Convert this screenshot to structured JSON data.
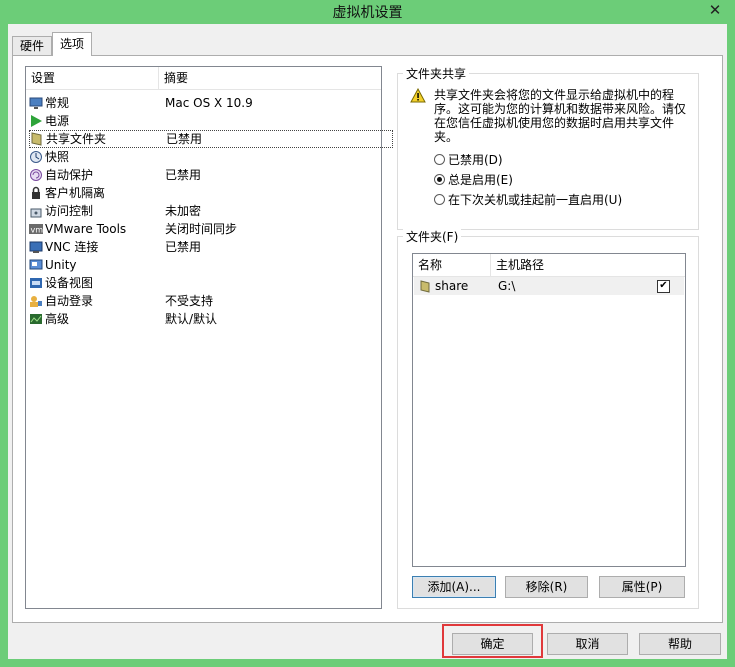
{
  "window": {
    "title": "虚拟机设置",
    "close_glyph": "✕"
  },
  "tabs": [
    {
      "label": "硬件"
    },
    {
      "label": "选项"
    }
  ],
  "settings_list": {
    "columns": [
      "设置",
      "摘要"
    ],
    "items": [
      {
        "name": "常规",
        "summary": "Mac OS X 10.9",
        "icon": "monitor-icon"
      },
      {
        "name": "电源",
        "summary": "",
        "icon": "play-icon"
      },
      {
        "name": "共享文件夹",
        "summary": "已禁用",
        "icon": "shared-folder-icon"
      },
      {
        "name": "快照",
        "summary": "",
        "icon": "snapshot-icon"
      },
      {
        "name": "自动保护",
        "summary": "已禁用",
        "icon": "autoprotect-icon"
      },
      {
        "name": "客户机隔离",
        "summary": "",
        "icon": "lock-icon"
      },
      {
        "name": "访问控制",
        "summary": "未加密",
        "icon": "access-control-icon"
      },
      {
        "name": "VMware Tools",
        "summary": "关闭时间同步",
        "icon": "vm-icon"
      },
      {
        "name": "VNC 连接",
        "summary": "已禁用",
        "icon": "vnc-icon"
      },
      {
        "name": "Unity",
        "summary": "",
        "icon": "unity-icon"
      },
      {
        "name": "设备视图",
        "summary": "",
        "icon": "device-view-icon"
      },
      {
        "name": "自动登录",
        "summary": "不受支持",
        "icon": "autologin-icon"
      },
      {
        "name": "高级",
        "summary": "默认/默认",
        "icon": "advanced-icon"
      }
    ]
  },
  "sharing": {
    "title": "文件夹共享",
    "warning": "共享文件夹会将您的文件显示给虚拟机中的程序。这可能为您的计算机和数据带来风险。请仅在您信任虚拟机使用您的数据时启用共享文件夹。",
    "options": [
      {
        "label": "已禁用(D)",
        "checked": false
      },
      {
        "label": "总是启用(E)",
        "checked": true
      },
      {
        "label": "在下次关机或挂起前一直启用(U)",
        "checked": false
      }
    ]
  },
  "folders": {
    "title": "文件夹(F)",
    "columns": [
      "名称",
      "主机路径"
    ],
    "rows": [
      {
        "name": "share",
        "path": "G:\\",
        "enabled": "✔"
      }
    ],
    "buttons": {
      "add": "添加(A)...",
      "remove": "移除(R)",
      "properties": "属性(P)"
    }
  },
  "footer": {
    "ok": "确定",
    "cancel": "取消",
    "help": "帮助"
  }
}
